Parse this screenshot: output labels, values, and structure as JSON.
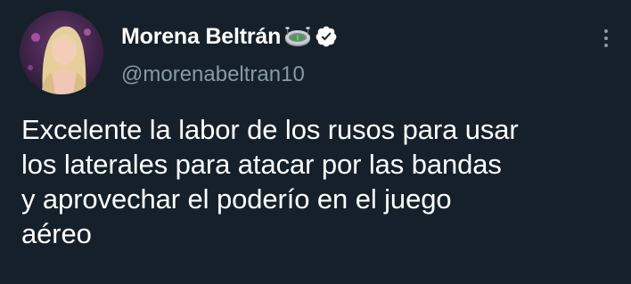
{
  "author": {
    "display_name": "Morena Beltrán",
    "handle": "@morenabeltran10",
    "name_emoji_icon": "stadium-icon",
    "verified_icon": "verified-badge-icon"
  },
  "menu_icon": "more-vertical-icon",
  "tweet": {
    "text": "Excelente la labor de los rusos para usar\nlos laterales para atacar por las bandas\ny aprovechar el poderío en el juego\naéreo"
  },
  "colors": {
    "background": "#15202b",
    "primary_text": "#ffffff",
    "secondary_text": "#8899a6"
  }
}
